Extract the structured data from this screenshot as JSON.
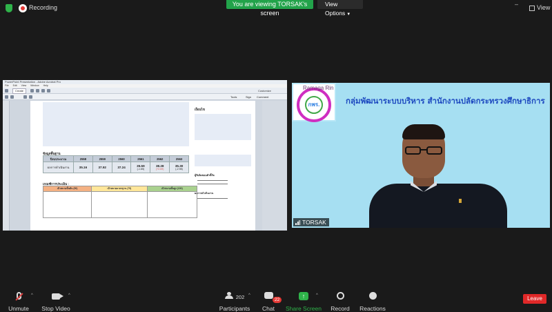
{
  "topbar": {
    "recording_label": "Recording",
    "share_banner": "You are viewing TORSAK's screen",
    "view_options_label": "View Options",
    "view_label": "View"
  },
  "acrobat": {
    "title": "PowerPoint Presentation - Adobe Acrobat Pro",
    "menu": [
      "File",
      "Edit",
      "View",
      "Window",
      "Help"
    ],
    "create_label": "Create",
    "customize_label": "Customize",
    "tools_label": "Tools",
    "sign_label": "Sign",
    "comment_label": "Comment",
    "page": {
      "data_title": "ข้อมูลพื้นฐาน",
      "table_headers": [
        "ปีงบประมาณ",
        "2558",
        "2559",
        "2560",
        "2561",
        "2562",
        "2563"
      ],
      "row_label": "ผลการดำเนินงาน",
      "values": [
        "35.16",
        "37.92",
        "37.24",
        "35.59",
        "38.28",
        "35.30"
      ],
      "changes": [
        "",
        "",
        "",
        "(-1.65)",
        "(+2.69)",
        "(-2.98)"
      ],
      "criteria_title": "เกณฑ์การประเมิน :",
      "criteria_headers": [
        "เป้าหมายขั้นต้น (50)",
        "เป้าหมายมาตรฐาน (75)",
        "เป้าหมายขั้นสูง (100)"
      ],
      "side_title": "เงื่อนไข",
      "side_label1": "ผู้รับผิดชอบตัวชี้วัด",
      "side_label2": "ผลการดำเนินงาน"
    }
  },
  "video": {
    "host_tag": "Ramaga Rin",
    "logo_text": "กพร.",
    "org_title": "กลุ่มพัฒนาระบบบริหาร  สำนักงานปลัดกระทรวงศึกษาธิการ",
    "participant_name": "TORSAK"
  },
  "controls": {
    "unmute": "Unmute",
    "stop_video": "Stop Video",
    "participants": "Participants",
    "participant_count": "202",
    "chat": "Chat",
    "chat_badge": "22",
    "share_screen": "Share Screen",
    "record": "Record",
    "reactions": "Reactions",
    "leave": "Leave"
  }
}
